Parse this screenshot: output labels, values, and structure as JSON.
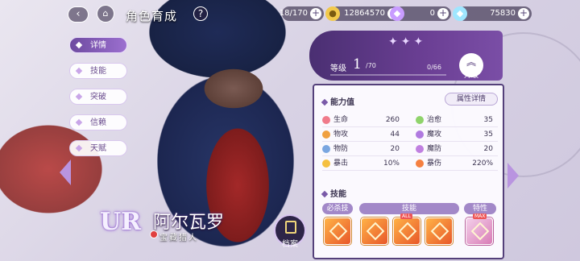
{
  "header": {
    "back_icon": "back-arrow-icon",
    "home_icon": "home-icon",
    "title": "角色育成",
    "help": "?"
  },
  "resources": [
    {
      "icon": "stamina-icon",
      "value": "18/170",
      "color": "#8fd6ff"
    },
    {
      "icon": "gold-coin-icon",
      "value": "12864570",
      "color": "#f2c94c"
    },
    {
      "icon": "purple-gem-icon",
      "value": "0",
      "color": "#c89cff"
    },
    {
      "icon": "diamond-icon",
      "value": "75830",
      "color": "#9fe6ff"
    }
  ],
  "nav": [
    {
      "label": "详情",
      "active": true
    },
    {
      "label": "技能",
      "active": false
    },
    {
      "label": "突破",
      "active": false
    },
    {
      "label": "信赖",
      "active": false
    },
    {
      "label": "天赋",
      "active": false
    }
  ],
  "character": {
    "rarity": "UR",
    "name": "阿尔瓦罗",
    "title": "宝藏猎人",
    "archive_label": "档案"
  },
  "level": {
    "label": "等级",
    "value": "1",
    "max": "/70",
    "exp": "0/66",
    "exp_fraction": 0,
    "upgrade_label": "升级"
  },
  "stats": {
    "section_title": "能力值",
    "detail_button": "属性详情",
    "rows": [
      [
        {
          "name": "生命",
          "value": "260",
          "icon_color": "#f07a8a"
        },
        {
          "name": "治愈",
          "value": "35",
          "icon_color": "#8fd36b"
        }
      ],
      [
        {
          "name": "物攻",
          "value": "44",
          "icon_color": "#f0a040"
        },
        {
          "name": "魔攻",
          "value": "35",
          "icon_color": "#b07ae0"
        }
      ],
      [
        {
          "name": "物防",
          "value": "20",
          "icon_color": "#7aa6e0"
        },
        {
          "name": "魔防",
          "value": "20",
          "icon_color": "#c080e0"
        }
      ],
      [
        {
          "name": "暴击",
          "value": "10%",
          "icon_color": "#f5c040"
        },
        {
          "name": "暴伤",
          "value": "220%",
          "icon_color": "#f58040"
        }
      ]
    ]
  },
  "skills": {
    "section_title": "技能",
    "ultimate_label": "必杀技",
    "skill_label": "技能",
    "trait_label": "特性",
    "badge_all": "ALL",
    "badge_max": "MAX"
  }
}
